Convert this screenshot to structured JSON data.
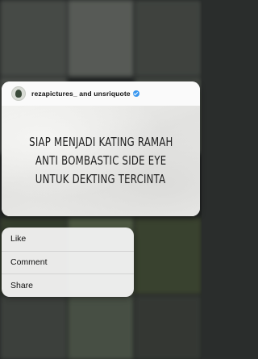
{
  "post": {
    "author": "rezapictures_ and unsriquote",
    "quote_lines": [
      "SIAP MENJADI KATING RAMAH",
      "ANTI BOMBASTIC SIDE EYE",
      "UNTUK DEKTING TERCINTA"
    ]
  },
  "menu": {
    "items": [
      "Like",
      "Comment",
      "Share"
    ]
  },
  "colors": {
    "verified": "#3897f0",
    "card_bg": "#ececea",
    "menu_bg": "#f5f5f5"
  },
  "icons": {
    "verified_badge": "verified-badge-icon",
    "avatar": "profile-avatar"
  }
}
